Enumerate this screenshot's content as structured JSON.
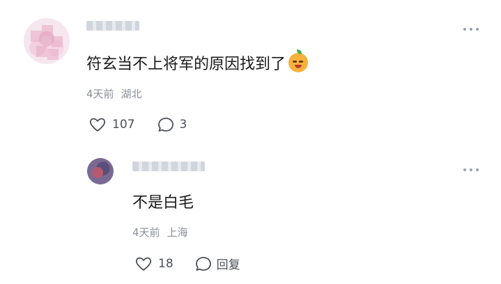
{
  "comment": {
    "text": "符玄当不上将军的原因找到了",
    "emoji": "grinning-orange-emoji",
    "time": "4天前",
    "location": "湖北",
    "likes": "107",
    "replies": "3"
  },
  "reply": {
    "text": "不是白毛",
    "time": "4天前",
    "location": "上海",
    "likes": "18",
    "reply_label": "回复"
  },
  "icons": {
    "like": "heart-outline-icon",
    "comment": "speech-bubble-icon",
    "more": "more-dots-icon"
  },
  "colors": {
    "text": "#1a1a1a",
    "meta": "#8a8f97",
    "icon": "#4b4f55"
  }
}
